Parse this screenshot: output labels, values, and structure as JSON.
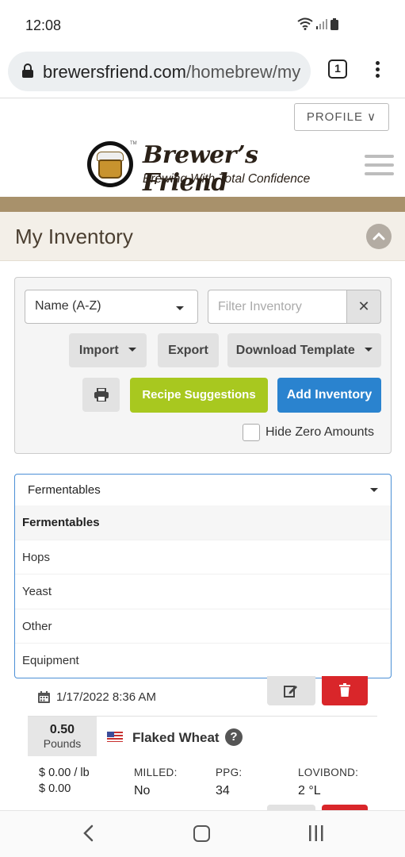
{
  "status_bar": {
    "time": "12:08"
  },
  "browser": {
    "url_domain": "brewersfriend.com",
    "url_path": "/homebrew/my",
    "tab_count": "1"
  },
  "site": {
    "profile_label": "PROFILE ∨",
    "brand_name": "Brewer’s Friend",
    "brand_tagline": "Brewing With Total Confidence",
    "tm": "TM"
  },
  "page": {
    "title": "My Inventory"
  },
  "controls": {
    "sort_value": "Name (A-Z)",
    "filter_placeholder": "Filter Inventory",
    "clear_label": "✕",
    "import_label": "Import",
    "export_label": "Export",
    "download_template_label": "Download Template",
    "recipe_suggestions_label": "Recipe Suggestions",
    "add_inventory_label": "Add Inventory",
    "hide_zero_label": "Hide Zero Amounts"
  },
  "category": {
    "selected": "Fermentables",
    "options": [
      "Fermentables",
      "Hops",
      "Yeast",
      "Other",
      "Equipment"
    ]
  },
  "item": {
    "date": "1/17/2022 8:36 AM",
    "amount": "0.50",
    "unit": "Pounds",
    "name": "Flaked Wheat",
    "help": "?",
    "price_per_unit": "$ 0.00 / lb",
    "price_total": "$ 0.00",
    "milled_label": "MILLED:",
    "milled_value": "No",
    "ppg_label": "PPG:",
    "ppg_value": "34",
    "lovibond_label": "LOVIBOND:",
    "lovibond_value": "2 °L"
  },
  "colors": {
    "accent_blue": "#2a83cf",
    "recipe_green": "#a8c81f",
    "delete_red": "#d9262a",
    "brown_band": "#a8916b"
  }
}
